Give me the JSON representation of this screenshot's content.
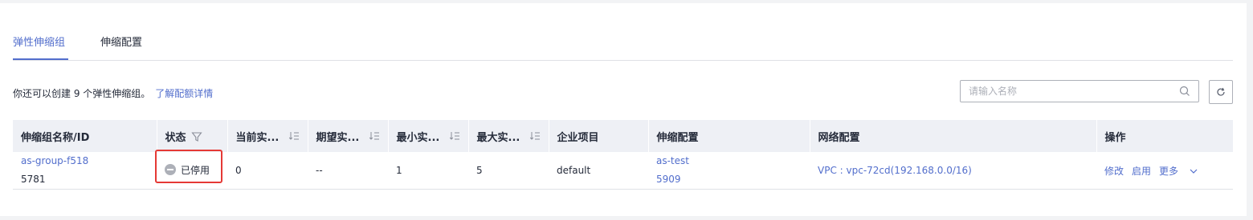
{
  "tabs": [
    {
      "label": "弹性伸缩组",
      "active": true
    },
    {
      "label": "伸缩配置",
      "active": false
    }
  ],
  "quota": {
    "text": "你还可以创建 9 个弹性伸缩组。",
    "link": "了解配额详情"
  },
  "search": {
    "placeholder": "请输入名称",
    "value": ""
  },
  "colors": {
    "accent": "#526ecc",
    "header_bg": "#eef0f5",
    "status_disabled": "#adb0b8",
    "highlight": "#e53935"
  },
  "table": {
    "columns": [
      {
        "label": "伸缩组名称/ID"
      },
      {
        "label": "状态",
        "icon": "filter-icon"
      },
      {
        "label": "当前实...",
        "icon": "sort-icon"
      },
      {
        "label": "期望实...",
        "icon": "sort-icon"
      },
      {
        "label": "最小实...",
        "icon": "sort-icon"
      },
      {
        "label": "最大实...",
        "icon": "sort-icon"
      },
      {
        "label": "企业项目"
      },
      {
        "label": "伸缩配置"
      },
      {
        "label": "网络配置"
      },
      {
        "label": "操作"
      }
    ],
    "rows": [
      {
        "name": "as-group-f518",
        "id": "5781",
        "status": "已停用",
        "current": "0",
        "desired": "--",
        "min": "1",
        "max": "5",
        "enterprise_project": "default",
        "config_name": "as-test",
        "config_id": "5909",
        "network": "VPC : vpc-72cd(192.168.0.0/16)",
        "actions": {
          "modify": "修改",
          "enable": "启用",
          "more": "更多"
        }
      }
    ]
  }
}
